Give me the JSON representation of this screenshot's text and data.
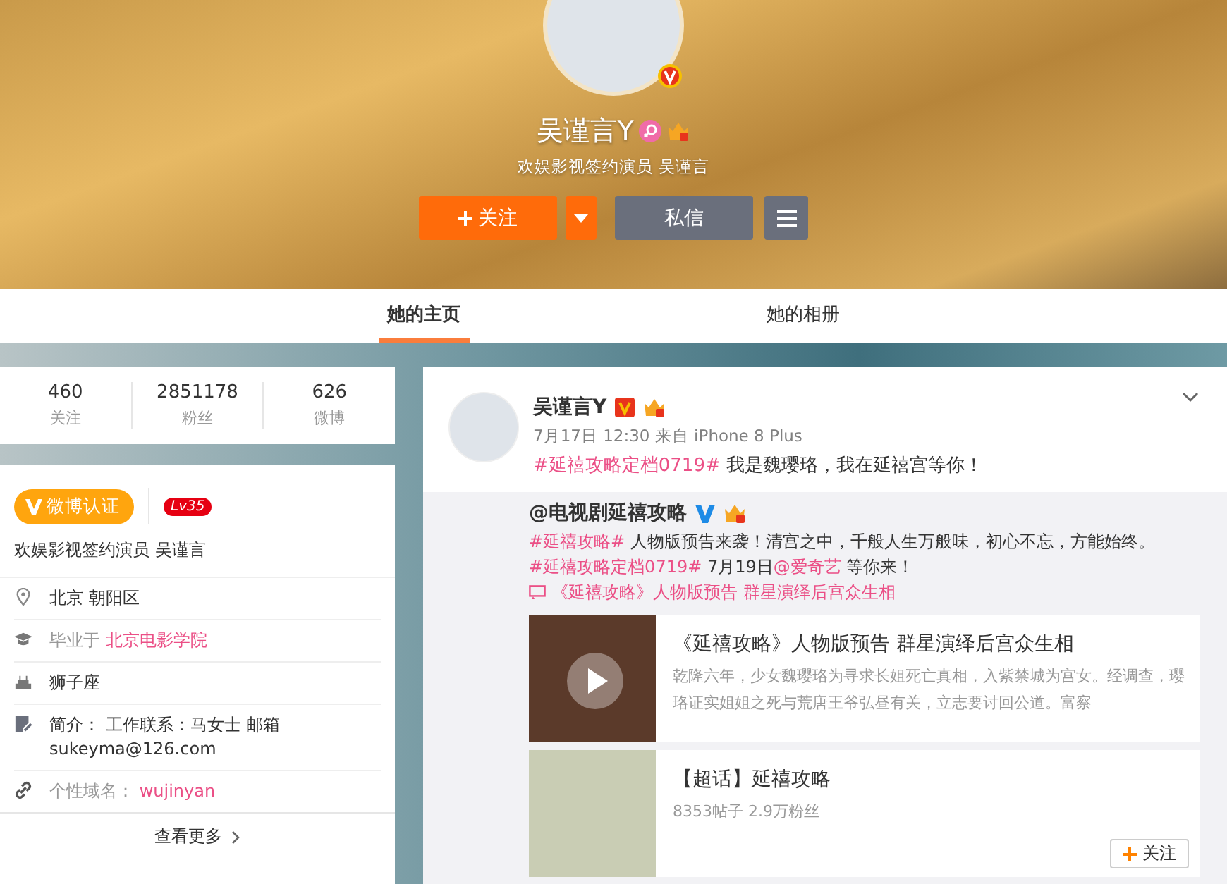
{
  "banner": {
    "name": "吴谨言Y",
    "subtitle": "欢娱影视签约演员 吴谨言",
    "follow_button": "关注",
    "message_button": "私信"
  },
  "tabs": [
    {
      "label": "她的主页",
      "selected": true
    },
    {
      "label": "她的相册",
      "selected": false
    }
  ],
  "stats": [
    {
      "value": "460",
      "label": "关注"
    },
    {
      "value": "2851178",
      "label": "粉丝"
    },
    {
      "value": "626",
      "label": "微博"
    }
  ],
  "profile": {
    "verified_label": "微博认证",
    "level": "Lv35",
    "description": "欢娱影视签约演员 吴谨言",
    "details": [
      {
        "kind": "location",
        "value": "北京 朝阳区"
      },
      {
        "kind": "school",
        "label": "毕业于",
        "value": "北京电影学院"
      },
      {
        "kind": "birthday",
        "value": "狮子座"
      },
      {
        "kind": "bio",
        "label": "简介：",
        "value": "工作联系：马女士 邮箱 sukeyma@126.com"
      },
      {
        "kind": "domain",
        "label": "个性域名：",
        "value": "wujinyan"
      }
    ],
    "more": "查看更多"
  },
  "post": {
    "author": "吴谨言Y",
    "time": "7月17日 12:30 来自 iPhone 8 Plus",
    "text": [
      {
        "kind": "hashtag",
        "text": "#延禧攻略定档0719#"
      },
      {
        "kind": "plain",
        "text": " 我是魏璎珞，我在延禧宫等你！"
      }
    ],
    "repost": {
      "author": "@电视剧延禧攻略",
      "text": [
        {
          "kind": "hashtag",
          "text": "#延禧攻略#"
        },
        {
          "kind": "plain",
          "text": " 人物版预告来袭！清宫之中，千般人生万般味，初心不忘，方能始终。"
        },
        {
          "kind": "hashtag",
          "text": "#延禧攻略定档0719#"
        },
        {
          "kind": "plain",
          "text": " 7月19日"
        },
        {
          "kind": "mention",
          "text": "@爱奇艺"
        },
        {
          "kind": "plain",
          "text": " 等你来！ "
        },
        {
          "kind": "video",
          "text": "《延禧攻略》人物版预告 群星演绎后宫众生相"
        }
      ],
      "cards": [
        {
          "kind": "video",
          "title": "《延禧攻略》人物版预告 群星演绎后宫众生相",
          "summary": "乾隆六年，少女魏璎珞为寻求长姐死亡真相，入紫禁城为宫女。经调查，璎珞证实姐姐之死与荒唐王爷弘昼有关，立志要讨回公道。富察"
        },
        {
          "kind": "topic",
          "title": "【超话】延禧攻略",
          "meta": "8353帖子 2.9万粉丝",
          "button": "关注"
        }
      ]
    }
  }
}
